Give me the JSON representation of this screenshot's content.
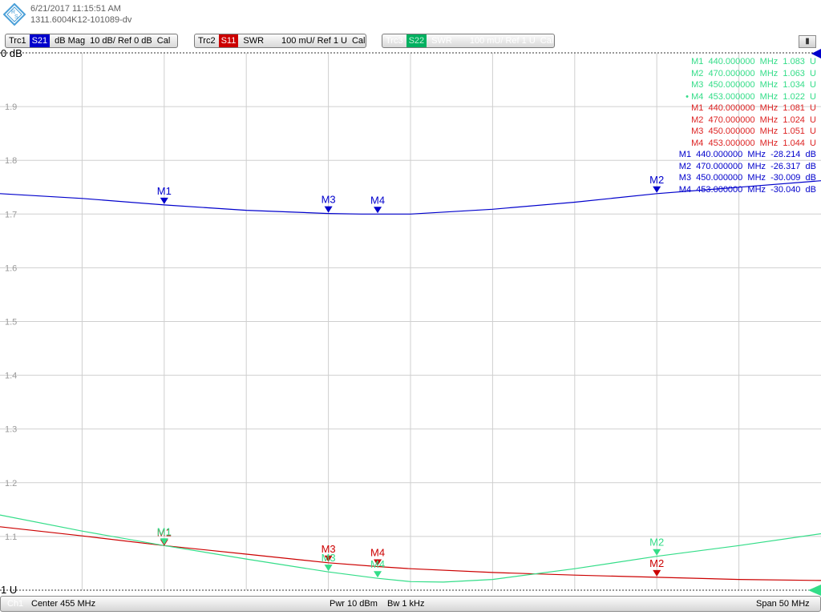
{
  "header": {
    "datetime": "6/21/2017 11:15:51 AM",
    "device_id": "1311.6004K12-101089-dv"
  },
  "traces": [
    {
      "name": "Trc1",
      "param": "S21",
      "format": "dB Mag",
      "scale": "10 dB/ Ref 0 dB",
      "cal": "Cal",
      "color": "#0000cc",
      "active": true
    },
    {
      "name": "Trc2",
      "param": "S11",
      "format": "SWR",
      "scale": "100 mU/ Ref 1 U",
      "cal": "Cal",
      "color": "#cc0000",
      "active": true
    },
    {
      "name": "Trc3",
      "param": "S22",
      "format": "SWR",
      "scale": "100 mU/ Ref 1 U",
      "cal": "Cal",
      "color": "#00b060",
      "active": false
    }
  ],
  "axis": {
    "top_label": "0 dB",
    "bottom_label": "1 U"
  },
  "marker_table": {
    "green": [
      {
        "mk": "M1",
        "freq": "440.000000",
        "unit": "MHz",
        "val": "1.083",
        "vunit": "U",
        "active": false
      },
      {
        "mk": "M2",
        "freq": "470.000000",
        "unit": "MHz",
        "val": "1.063",
        "vunit": "U",
        "active": false
      },
      {
        "mk": "M3",
        "freq": "450.000000",
        "unit": "MHz",
        "val": "1.034",
        "vunit": "U",
        "active": false
      },
      {
        "mk": "M4",
        "freq": "453.000000",
        "unit": "MHz",
        "val": "1.022",
        "vunit": "U",
        "active": true
      }
    ],
    "red": [
      {
        "mk": "M1",
        "freq": "440.000000",
        "unit": "MHz",
        "val": "1.081",
        "vunit": "U"
      },
      {
        "mk": "M2",
        "freq": "470.000000",
        "unit": "MHz",
        "val": "1.024",
        "vunit": "U"
      },
      {
        "mk": "M3",
        "freq": "450.000000",
        "unit": "MHz",
        "val": "1.051",
        "vunit": "U"
      },
      {
        "mk": "M4",
        "freq": "453.000000",
        "unit": "MHz",
        "val": "1.044",
        "vunit": "U"
      }
    ],
    "blue": [
      {
        "mk": "M1",
        "freq": "440.000000",
        "unit": "MHz",
        "val": "-28.214",
        "vunit": "dB"
      },
      {
        "mk": "M2",
        "freq": "470.000000",
        "unit": "MHz",
        "val": "-26.317",
        "vunit": "dB"
      },
      {
        "mk": "M3",
        "freq": "450.000000",
        "unit": "MHz",
        "val": "-30.009",
        "vunit": "dB"
      },
      {
        "mk": "M4",
        "freq": "453.000000",
        "unit": "MHz",
        "val": "-30.040",
        "vunit": "dB"
      }
    ]
  },
  "footer": {
    "channel": "Ch1",
    "center": "Center  455 MHz",
    "power": "Pwr  10 dBm",
    "bandwidth": "Bw  1 kHz",
    "span": "Span  50 MHz"
  },
  "chart_data": {
    "type": "line",
    "xlim": [
      430,
      480
    ],
    "x_unit": "MHz",
    "ylim": [
      1.0,
      2.0
    ],
    "y_ticks": [
      "1.9",
      "1.8",
      "1.7",
      "1.6",
      "1.5",
      "1.4",
      "1.3",
      "1.2",
      "1.1"
    ],
    "y_tick_values": [
      1.9,
      1.8,
      1.7,
      1.6,
      1.5,
      1.4,
      1.3,
      1.2,
      1.1
    ],
    "grid": true,
    "series": [
      {
        "color": "#0000cc",
        "x": [
          430,
          435,
          440,
          445,
          450,
          452,
          453,
          455,
          460,
          465,
          470,
          475,
          480
        ],
        "y": [
          1.738,
          1.729,
          1.717,
          1.707,
          1.701,
          1.7,
          1.7,
          1.7,
          1.709,
          1.722,
          1.738,
          1.75,
          1.762
        ],
        "markers": [
          {
            "label": "M1",
            "x": 440,
            "y": 1.717
          },
          {
            "label": "M2",
            "x": 470,
            "y": 1.738
          },
          {
            "label": "M3",
            "x": 450,
            "y": 1.701
          },
          {
            "label": "M4",
            "x": 453,
            "y": 1.7
          }
        ]
      },
      {
        "color": "#cc0000",
        "x": [
          430,
          435,
          440,
          445,
          450,
          453,
          455,
          460,
          465,
          470,
          475,
          480
        ],
        "y": [
          1.118,
          1.101,
          1.083,
          1.067,
          1.051,
          1.044,
          1.04,
          1.033,
          1.028,
          1.024,
          1.02,
          1.018
        ],
        "markers": [
          {
            "label": "M1",
            "x": 440,
            "y": 1.081
          },
          {
            "label": "M2",
            "x": 470,
            "y": 1.024
          },
          {
            "label": "M3",
            "x": 450,
            "y": 1.051
          },
          {
            "label": "M4",
            "x": 453,
            "y": 1.044
          }
        ]
      },
      {
        "color": "#33dd88",
        "x": [
          430,
          435,
          440,
          445,
          450,
          453,
          455,
          457,
          460,
          465,
          470,
          475,
          480
        ],
        "y": [
          1.14,
          1.11,
          1.083,
          1.058,
          1.034,
          1.022,
          1.016,
          1.015,
          1.02,
          1.04,
          1.063,
          1.083,
          1.105
        ],
        "markers": [
          {
            "label": "M1",
            "x": 440,
            "y": 1.083
          },
          {
            "label": "M2",
            "x": 470,
            "y": 1.063
          },
          {
            "label": "M3",
            "x": 450,
            "y": 1.034
          },
          {
            "label": "M4",
            "x": 453,
            "y": 1.022
          }
        ]
      }
    ]
  }
}
